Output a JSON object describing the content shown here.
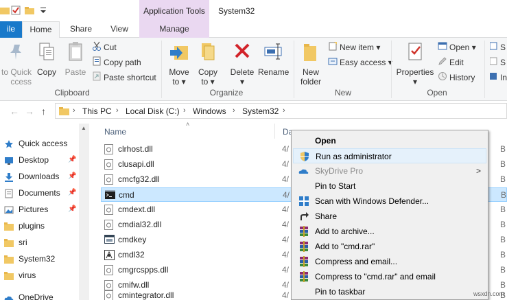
{
  "window": {
    "title": "System32",
    "context_tab_group": "Application Tools"
  },
  "tabs": {
    "file": "ile",
    "home": "Home",
    "share": "Share",
    "view": "View",
    "manage": "Manage"
  },
  "ribbon": {
    "clipboard": {
      "label": "Clipboard",
      "pin_line1": "to Quick",
      "pin_line2": "ccess",
      "copy": "Copy",
      "paste": "Paste",
      "cut": "Cut",
      "copy_path": "Copy path",
      "paste_shortcut": "Paste shortcut"
    },
    "organize": {
      "label": "Organize",
      "move_to_1": "Move",
      "move_to_2": "to",
      "copy_to_1": "Copy",
      "copy_to_2": "to",
      "delete": "Delete",
      "rename": "Rename"
    },
    "new": {
      "label": "New",
      "new_folder_1": "New",
      "new_folder_2": "folder",
      "new_item": "New item",
      "easy_access": "Easy access"
    },
    "open": {
      "label": "Open",
      "properties": "Properties",
      "open": "Open",
      "edit": "Edit",
      "history": "History"
    },
    "select": {
      "s1": "S",
      "s2": "S",
      "s3": "In"
    }
  },
  "address": {
    "crumbs": [
      "This PC",
      "Local Disk (C:)",
      "Windows",
      "System32"
    ]
  },
  "navpane": {
    "items": [
      {
        "label": "Quick access",
        "icon": "star-icon",
        "pinned": false
      },
      {
        "label": "Desktop",
        "icon": "desktop-icon",
        "pinned": true
      },
      {
        "label": "Downloads",
        "icon": "download-icon",
        "pinned": true
      },
      {
        "label": "Documents",
        "icon": "documents-icon",
        "pinned": true
      },
      {
        "label": "Pictures",
        "icon": "pictures-icon",
        "pinned": true
      },
      {
        "label": "plugins",
        "icon": "folder-icon",
        "pinned": false
      },
      {
        "label": "sri",
        "icon": "folder-icon",
        "pinned": false
      },
      {
        "label": "System32",
        "icon": "folder-icon",
        "pinned": false
      },
      {
        "label": "virus",
        "icon": "folder-icon",
        "pinned": false
      },
      {
        "label": "OneDrive",
        "icon": "cloud-icon",
        "pinned": false
      }
    ]
  },
  "filelist": {
    "col_name": "Name",
    "col_date": "Da",
    "rows": [
      {
        "name": "clrhost.dll",
        "date": "4/",
        "size": "B",
        "icon": "dll-icon"
      },
      {
        "name": "clusapi.dll",
        "date": "4/",
        "size": "B",
        "icon": "dll-icon"
      },
      {
        "name": "cmcfg32.dll",
        "date": "4/",
        "size": "B",
        "icon": "dll-icon"
      },
      {
        "name": "cmd",
        "date": "4/",
        "size": "B",
        "icon": "console-icon"
      },
      {
        "name": "cmdext.dll",
        "date": "4/",
        "size": "B",
        "icon": "dll-icon"
      },
      {
        "name": "cmdial32.dll",
        "date": "4/",
        "size": "B",
        "icon": "dll-icon"
      },
      {
        "name": "cmdkey",
        "date": "4/",
        "size": "B",
        "icon": "app-icon"
      },
      {
        "name": "cmdl32",
        "date": "4/",
        "size": "B",
        "icon": "app-icon"
      },
      {
        "name": "cmgrcspps.dll",
        "date": "4/",
        "size": "B",
        "icon": "dll-icon"
      },
      {
        "name": "cmifw.dll",
        "date": "4/",
        "size": "B",
        "icon": "dll-icon"
      },
      {
        "name": "cmintegrator.dll",
        "date": "4/",
        "size": "B",
        "icon": "dll-icon"
      }
    ]
  },
  "context_menu": {
    "items": [
      {
        "label": "Open",
        "bold": true
      },
      {
        "label": "Run as administrator",
        "highlight": true,
        "icon": "shield-icon"
      },
      {
        "label": "SkyDrive Pro",
        "disabled": true,
        "icon": "skydrive-icon",
        "submenu": true
      },
      {
        "label": "Pin to Start"
      },
      {
        "label": "Scan with Windows Defender...",
        "icon": "defender-icon"
      },
      {
        "label": "Share",
        "icon": "share-icon"
      },
      {
        "label": "Add to archive...",
        "icon": "winrar-icon"
      },
      {
        "label": "Add to \"cmd.rar\"",
        "icon": "winrar-icon"
      },
      {
        "label": "Compress and email...",
        "icon": "winrar-icon"
      },
      {
        "label": "Compress to \"cmd.rar\" and email",
        "icon": "winrar-icon"
      },
      {
        "label": "Pin to taskbar"
      }
    ]
  },
  "watermark": "wsxdn.com",
  "colors": {
    "accent": "#1979ca",
    "context_tab": "#ead8f1",
    "selection": "#cce8ff",
    "menu_highlight": "#e5f1fb"
  }
}
